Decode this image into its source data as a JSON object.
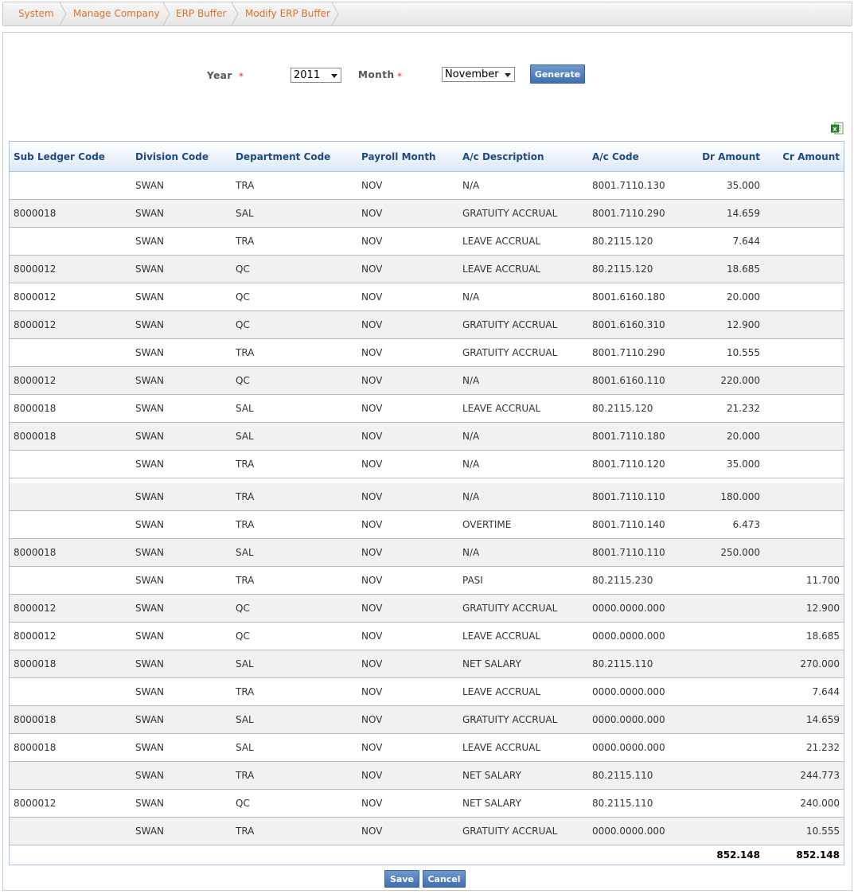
{
  "breadcrumb": [
    "System",
    "Manage Company",
    "ERP Buffer",
    "Modify ERP Buffer"
  ],
  "form": {
    "year_label": "Year",
    "month_label": "Month",
    "required_mark": "*",
    "year_value": "2011",
    "month_value": "November",
    "generate_label": "Generate"
  },
  "export_icon": "excel-icon",
  "columns": [
    "Sub Ledger Code",
    "Division Code",
    "Department Code",
    "Payroll Month",
    "A/c Description",
    "A/c Code",
    "Dr Amount",
    "Cr Amount"
  ],
  "rows": [
    [
      "",
      "SWAN",
      "TRA",
      "NOV",
      "N/A",
      "8001.7110.130",
      "35.000",
      ""
    ],
    [
      "8000018",
      "SWAN",
      "SAL",
      "NOV",
      "GRATUITY ACCRUAL",
      "8001.7110.290",
      "14.659",
      ""
    ],
    [
      "",
      "SWAN",
      "TRA",
      "NOV",
      "LEAVE ACCRUAL",
      "80.2115.120",
      "7.644",
      ""
    ],
    [
      "8000012",
      "SWAN",
      "QC",
      "NOV",
      "LEAVE ACCRUAL",
      "80.2115.120",
      "18.685",
      ""
    ],
    [
      "8000012",
      "SWAN",
      "QC",
      "NOV",
      "N/A",
      "8001.6160.180",
      "20.000",
      ""
    ],
    [
      "8000012",
      "SWAN",
      "QC",
      "NOV",
      "GRATUITY ACCRUAL",
      "8001.6160.310",
      "12.900",
      ""
    ],
    [
      "",
      "SWAN",
      "TRA",
      "NOV",
      "GRATUITY ACCRUAL",
      "8001.7110.290",
      "10.555",
      ""
    ],
    [
      "8000012",
      "SWAN",
      "QC",
      "NOV",
      "N/A",
      "8001.6160.110",
      "220.000",
      ""
    ],
    [
      "8000018",
      "SWAN",
      "SAL",
      "NOV",
      "LEAVE ACCRUAL",
      "80.2115.120",
      "21.232",
      ""
    ],
    [
      "8000018",
      "SWAN",
      "SAL",
      "NOV",
      "N/A",
      "8001.7110.180",
      "20.000",
      ""
    ],
    [
      "",
      "SWAN",
      "TRA",
      "NOV",
      "N/A",
      "8001.7110.120",
      "35.000",
      ""
    ],
    [
      "",
      "SWAN",
      "TRA",
      "NOV",
      "N/A",
      "8001.7110.110",
      "180.000",
      ""
    ],
    [
      "",
      "SWAN",
      "TRA",
      "NOV",
      "OVERTIME",
      "8001.7110.140",
      "6.473",
      ""
    ],
    [
      "8000018",
      "SWAN",
      "SAL",
      "NOV",
      "N/A",
      "8001.7110.110",
      "250.000",
      ""
    ],
    [
      "",
      "SWAN",
      "TRA",
      "NOV",
      "PASI",
      "80.2115.230",
      "",
      "11.700"
    ],
    [
      "8000012",
      "SWAN",
      "QC",
      "NOV",
      "GRATUITY ACCRUAL",
      "0000.0000.000",
      "",
      "12.900"
    ],
    [
      "8000012",
      "SWAN",
      "QC",
      "NOV",
      "LEAVE ACCRUAL",
      "0000.0000.000",
      "",
      "18.685"
    ],
    [
      "8000018",
      "SWAN",
      "SAL",
      "NOV",
      "NET SALARY",
      "80.2115.110",
      "",
      "270.000"
    ],
    [
      "",
      "SWAN",
      "TRA",
      "NOV",
      "LEAVE ACCRUAL",
      "0000.0000.000",
      "",
      "7.644"
    ],
    [
      "8000018",
      "SWAN",
      "SAL",
      "NOV",
      "GRATUITY ACCRUAL",
      "0000.0000.000",
      "",
      "14.659"
    ],
    [
      "8000018",
      "SWAN",
      "SAL",
      "NOV",
      "LEAVE ACCRUAL",
      "0000.0000.000",
      "",
      "21.232"
    ],
    [
      "",
      "SWAN",
      "TRA",
      "NOV",
      "NET SALARY",
      "80.2115.110",
      "",
      "244.773"
    ],
    [
      "8000012",
      "SWAN",
      "QC",
      "NOV",
      "NET SALARY",
      "80.2115.110",
      "",
      "240.000"
    ],
    [
      "",
      "SWAN",
      "TRA",
      "NOV",
      "GRATUITY ACCRUAL",
      "0000.0000.000",
      "",
      "10.555"
    ]
  ],
  "totals": {
    "dr": "852.148",
    "cr": "852.148"
  },
  "actions": {
    "save_label": "Save",
    "cancel_label": "Cancel"
  },
  "colors": {
    "accent": "#4472b4",
    "crumb_text": "#e0702a",
    "header_text": "#1e4a84"
  }
}
